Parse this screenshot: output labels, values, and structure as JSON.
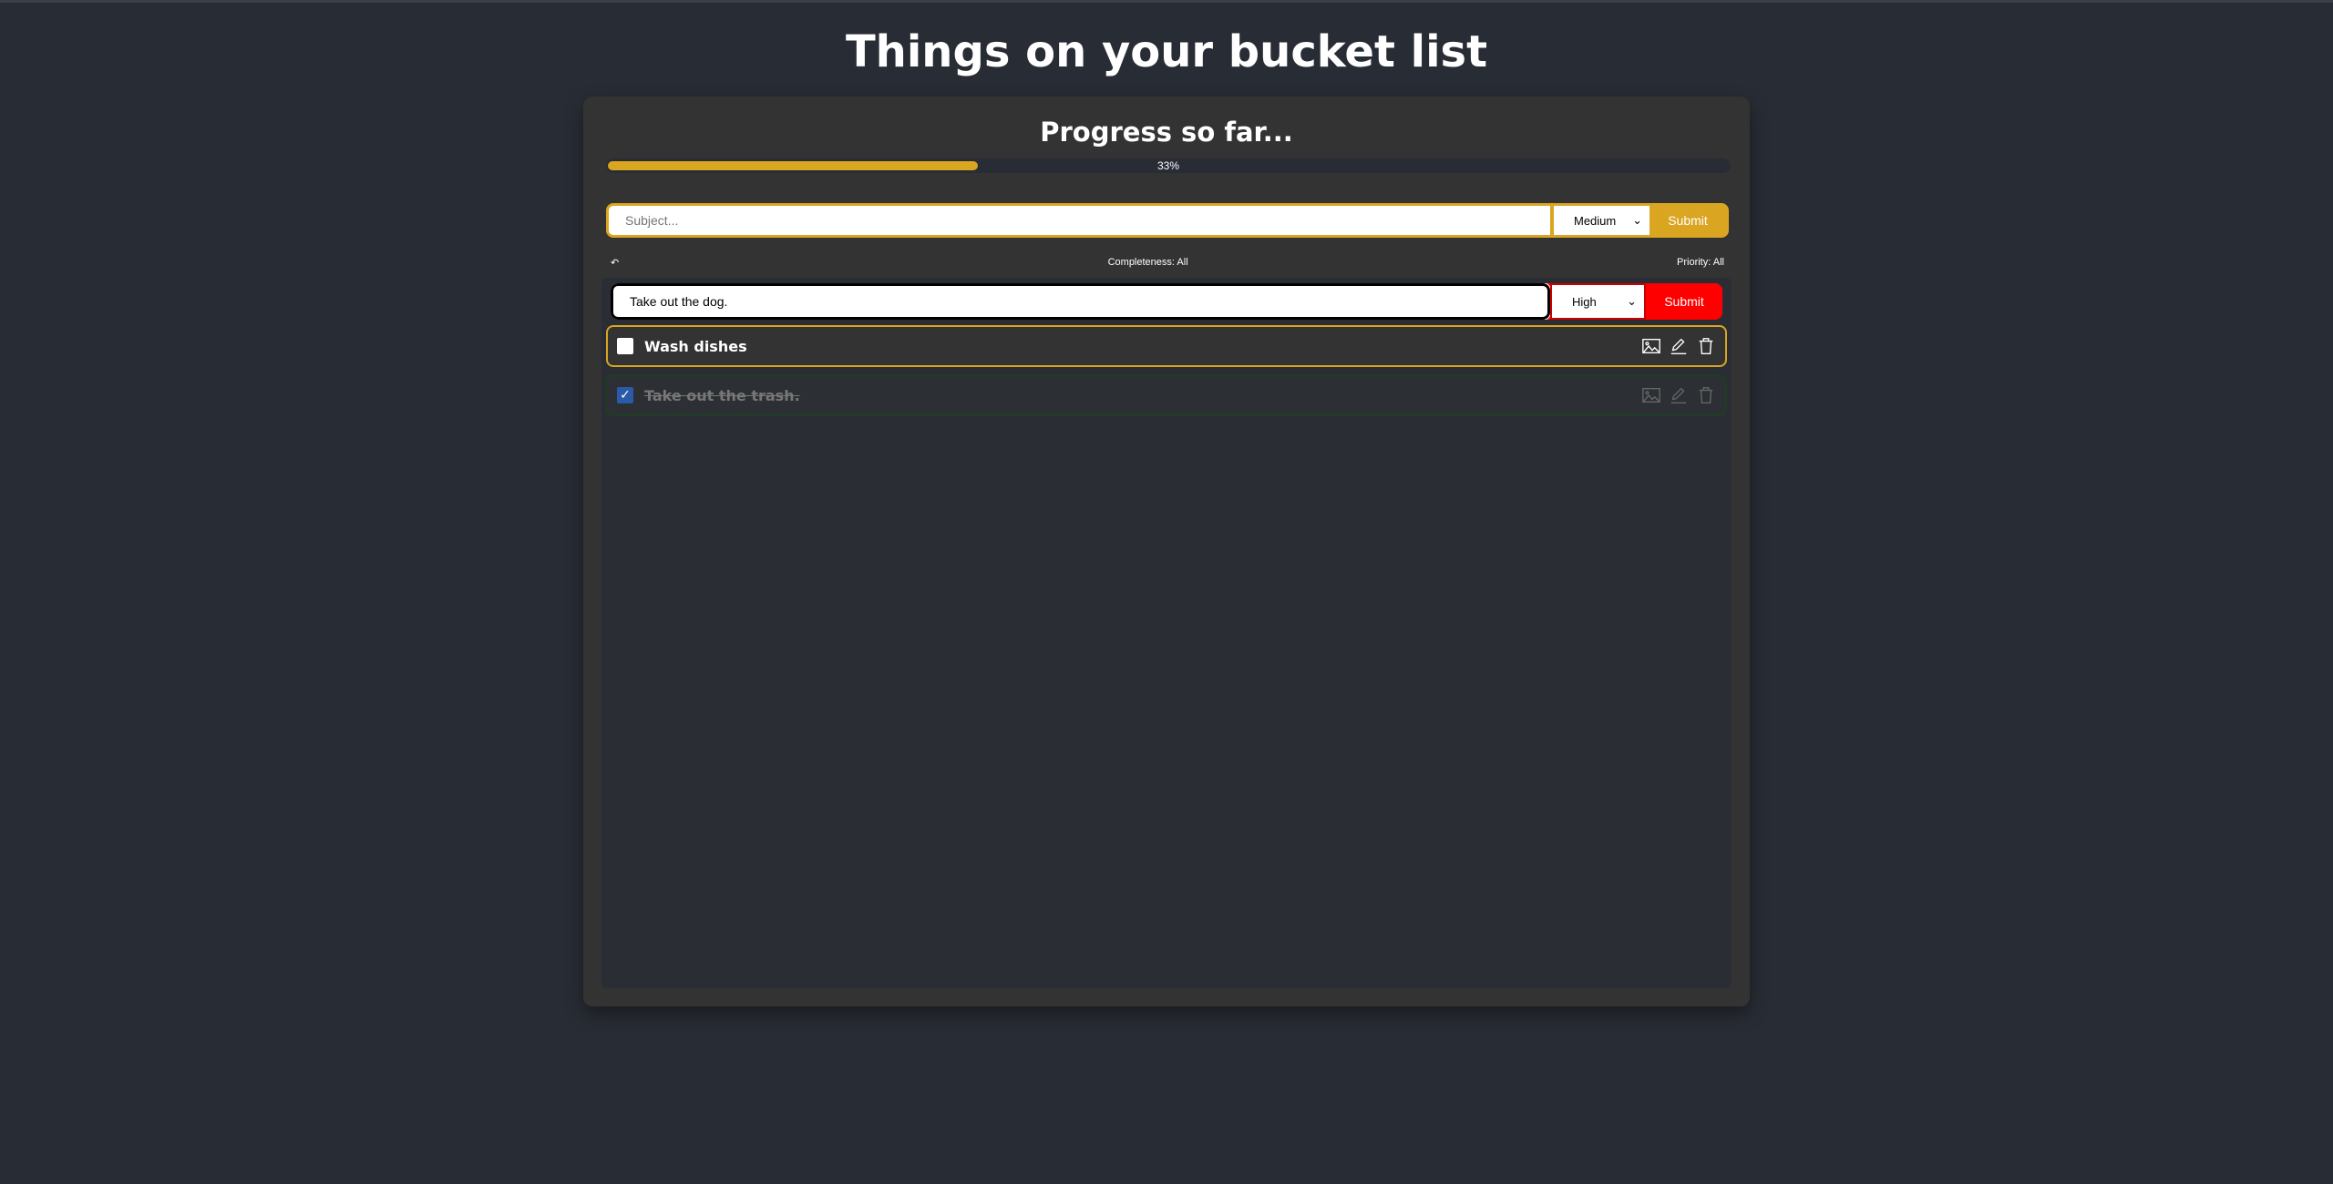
{
  "title": "Things on your bucket list",
  "progress": {
    "title": "Progress so far...",
    "percent": 33,
    "label": "33%"
  },
  "add": {
    "placeholder": "Subject...",
    "value": "",
    "priority": "Medium",
    "submit": "Submit"
  },
  "filters": {
    "undo_icon": "undo-arrow-icon",
    "completeness": "Completeness: All",
    "priority": "Priority: All"
  },
  "edit": {
    "value": "Take out the dog.",
    "priority": "High",
    "submit": "Submit"
  },
  "items": [
    {
      "text": "Wash dishes",
      "done": false,
      "priority_color": "#daa520"
    },
    {
      "text": "Take out the trash.",
      "done": true,
      "priority_color": "#1f3d22"
    }
  ],
  "colors": {
    "accent": "#daa520",
    "high": "#ff0000"
  }
}
